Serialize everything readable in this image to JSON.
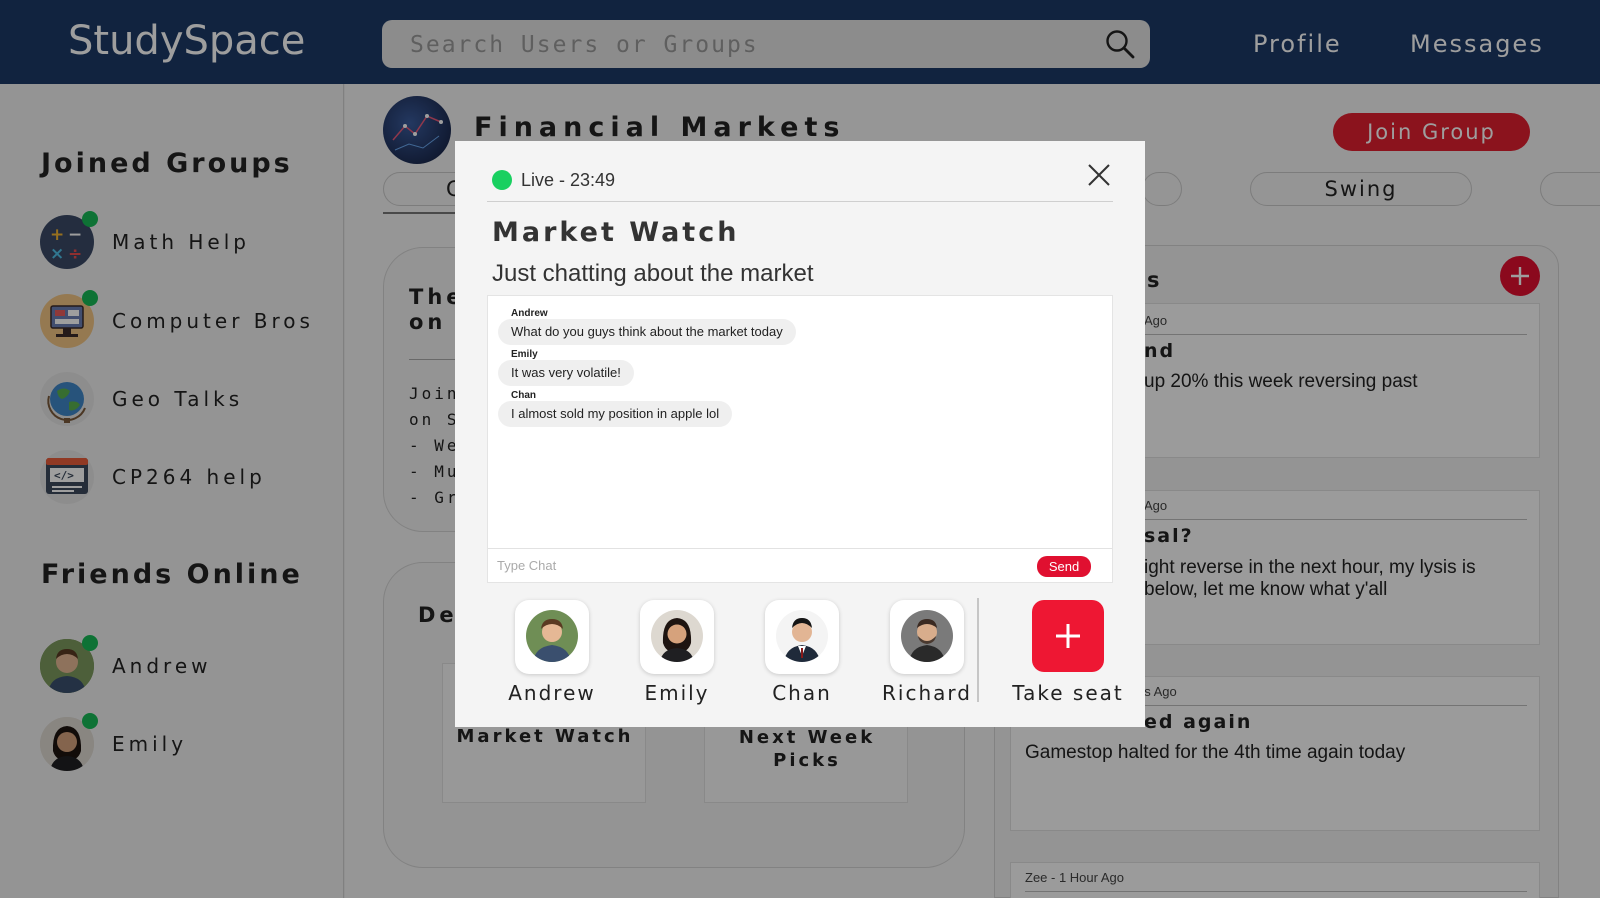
{
  "app": {
    "name": "StudySpace"
  },
  "search": {
    "placeholder": "Search Users or Groups"
  },
  "nav": {
    "profile": "Profile",
    "messages": "Messages"
  },
  "sidebar": {
    "joined_heading": "Joined Groups",
    "groups": [
      {
        "label": "Math Help"
      },
      {
        "label": "Computer Bros"
      },
      {
        "label": "Geo Talks"
      },
      {
        "label": "CP264 help"
      }
    ],
    "friends_heading": "Friends Online",
    "friends": [
      {
        "label": "Andrew"
      },
      {
        "label": "Emily"
      }
    ]
  },
  "group": {
    "title": "Financial Markets",
    "join_label": "Join Group",
    "tags": [
      "G",
      "Swing"
    ]
  },
  "background": {
    "card_title": [
      "The",
      "on"
    ],
    "card_lines": [
      "Join",
      "on S",
      "- We",
      "- Mu",
      "- Gre"
    ],
    "desc_heading": "Des",
    "rooms": [
      "Market Watch",
      "Next Week Picks"
    ],
    "posts_heading": "s",
    "posts": [
      {
        "meta": "Ago",
        "title": "nd",
        "body": "up 20% this week reversing past"
      },
      {
        "meta": "Ago",
        "title": "sal?",
        "body": "ight reverse in the next hour, my lysis is below, let me know what y'all"
      },
      {
        "meta": "es Ago",
        "title": "ed again",
        "body": "Gamestop halted for the 4th time again today"
      },
      {
        "meta": "Zee - 1 Hour Ago",
        "title": "",
        "body": ""
      }
    ]
  },
  "modal": {
    "status": "Live - 23:49",
    "title": "Market Watch",
    "description": "Just chatting about the market",
    "messages": [
      {
        "name": "Andrew",
        "text": "What do you guys think about the market today"
      },
      {
        "name": "Emily",
        "text": "It was very volatile!"
      },
      {
        "name": "Chan",
        "text": "I almost sold my position in apple lol"
      }
    ],
    "input_placeholder": "Type Chat",
    "send_label": "Send",
    "seats": [
      {
        "name": "Andrew"
      },
      {
        "name": "Emily"
      },
      {
        "name": "Chan"
      },
      {
        "name": "Richard"
      }
    ],
    "take_seat_label": "Take seat"
  },
  "colors": {
    "navbar": "#1c3966",
    "accent_red": "#e02030",
    "online_green": "#18b956",
    "live_green": "#19d060"
  }
}
